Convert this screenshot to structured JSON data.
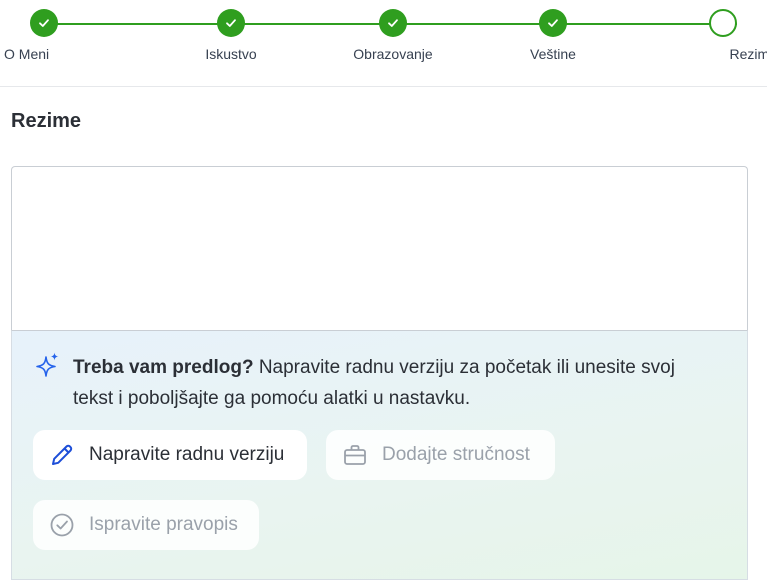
{
  "stepper": {
    "steps": [
      {
        "label": "O Meni",
        "status": "done"
      },
      {
        "label": "Iskustvo",
        "status": "done"
      },
      {
        "label": "Obrazovanje",
        "status": "done"
      },
      {
        "label": "Veštine",
        "status": "done"
      },
      {
        "label": "Rezime",
        "status": "current"
      }
    ],
    "accent_color": "#2f9e1f"
  },
  "section": {
    "title": "Rezime"
  },
  "editor": {
    "value": ""
  },
  "assist": {
    "icon": "sparkle-icon",
    "lead_bold": "Treba vam predlog?",
    "lead_text": " Napravite radnu verziju za početak ili unesite svoj tekst i poboljšajte ga pomoću alatki u nastavku.",
    "buttons": [
      {
        "label": "Napravite radnu verziju",
        "icon": "pencil-icon",
        "enabled": true
      },
      {
        "label": "Dodajte stručnost",
        "icon": "briefcase-icon",
        "enabled": false
      },
      {
        "label": "Ispravite pravopis",
        "icon": "check-circle-icon",
        "enabled": false
      }
    ]
  }
}
